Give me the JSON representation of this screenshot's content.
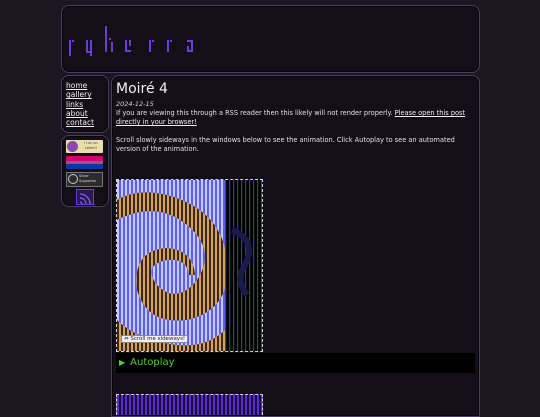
{
  "site": {
    "logo_text": "rykerra"
  },
  "nav": {
    "items": [
      {
        "label": "home"
      },
      {
        "label": "gallery"
      },
      {
        "label": "links"
      },
      {
        "label": "about"
      },
      {
        "label": "contact"
      }
    ]
  },
  "badges": {
    "badge1_text": "I run on cofee!!",
    "badge3_text": "Silver Supporter"
  },
  "post": {
    "title": "Moiré 4",
    "date": "2024-12-15",
    "rss_notice_prefix": "If you are viewing this through a RSS reader then this likely will not render properly. ",
    "rss_notice_link": "Please open this post directly in your browser!",
    "instructions": "Scroll slowly sideways in the windows below to see the animation. Click Autoplay to see an automated version of the animation.",
    "scroll_hint": "Scroll me sideways!",
    "autoplay_label": "Autoplay"
  },
  "colors": {
    "accent_purple": "#6f3bd8",
    "autoplay_green": "#4fd02a",
    "moire_blue": "#5b5ee8",
    "moire_orange": "#d8a05c"
  }
}
